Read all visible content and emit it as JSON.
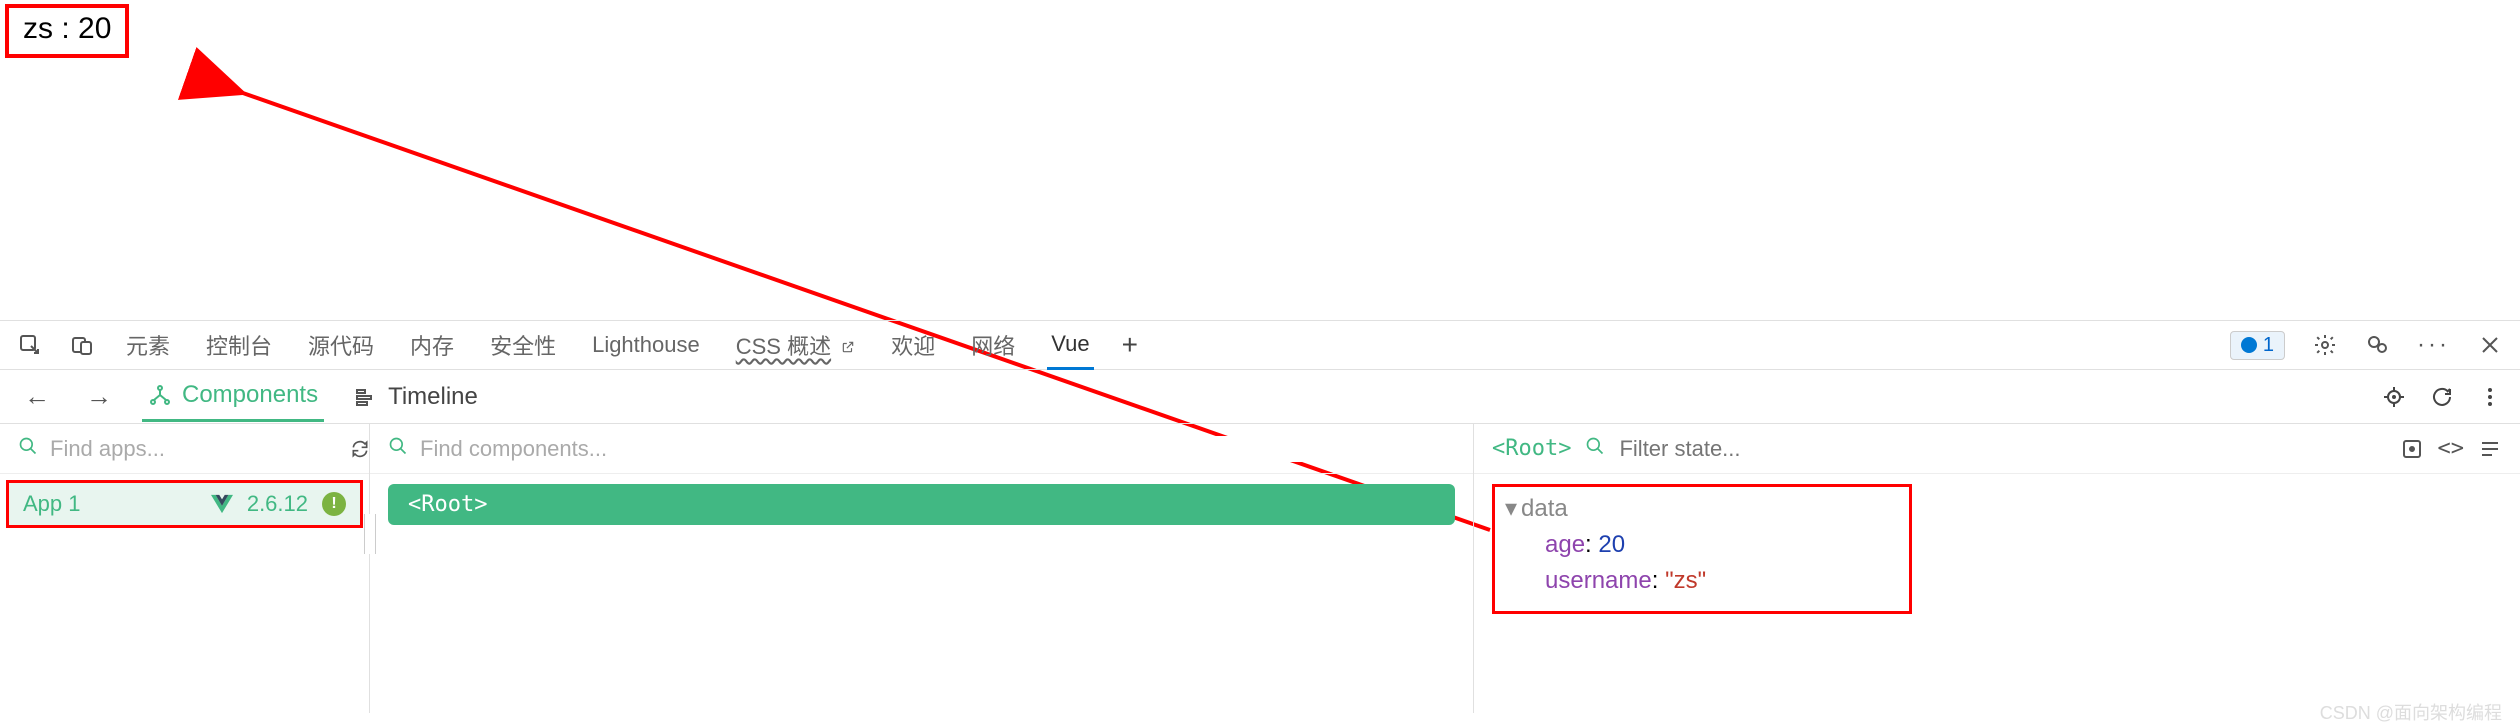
{
  "output": {
    "text": "zs : 20"
  },
  "devtools": {
    "tabs": {
      "elements": "元素",
      "console": "控制台",
      "sources": "源代码",
      "memory": "内存",
      "security": "安全性",
      "lighthouse": "Lighthouse",
      "css_overview": "CSS 概述",
      "welcome": "欢迎",
      "network": "网络",
      "vue": "Vue"
    },
    "issues_count": "1"
  },
  "vue_panel": {
    "tabs": {
      "components": "Components",
      "timeline": "Timeline"
    }
  },
  "apps": {
    "search_placeholder": "Find apps...",
    "items": [
      {
        "name": "App 1",
        "version": "2.6.12",
        "badge": "!"
      }
    ]
  },
  "tree": {
    "search_placeholder": "Find components...",
    "root_label": "<Root>"
  },
  "state": {
    "root_label": "<Root>",
    "filter_placeholder": "Filter state...",
    "section": "data",
    "data": {
      "age_key": "age",
      "age_val": "20",
      "username_key": "username",
      "username_val": "\"zs\""
    }
  },
  "watermark": "CSDN @面向架构编程"
}
